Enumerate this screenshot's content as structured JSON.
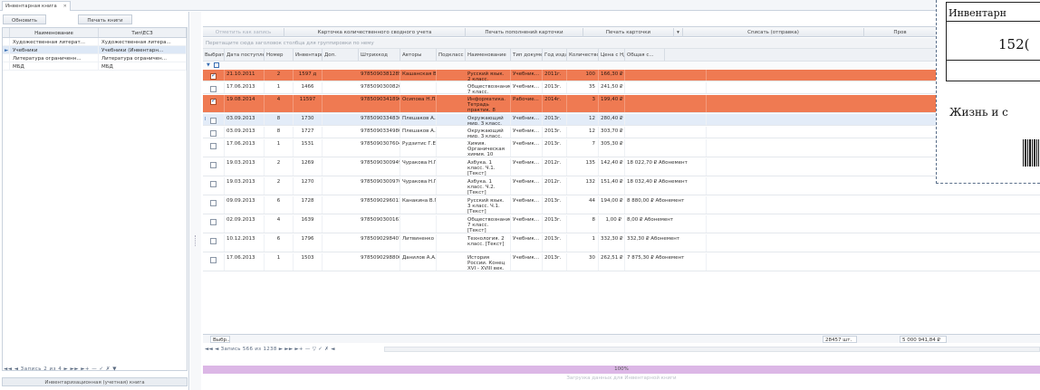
{
  "tabs": [
    {
      "label": "Инвентарная книга"
    }
  ],
  "left_panel": {
    "buttons": [
      "Обновить",
      "Печать книги"
    ],
    "columns": [
      "Наименование",
      "Тип\\ЕСЗ"
    ],
    "rows": [
      {
        "name": "Художественная литерат...",
        "type": "Художественная литера...",
        "selected": false
      },
      {
        "name": "Учебники",
        "type": "Учебники (Инвентарн...",
        "selected": true
      },
      {
        "name": "Литература ограниченн...",
        "type": "Литература ограничен...",
        "selected": false
      },
      {
        "name": "МБД",
        "type": "МБД",
        "selected": false
      }
    ],
    "nav_text": "◄◄ ◄ Запись 2 из 4 ► ►► ►+ — ✓ ✗ ▼",
    "footer": "Инвентаризационная (учетная) книга"
  },
  "toolbar": {
    "buttons": [
      {
        "label": "Отметить как запись",
        "disabled": true
      },
      {
        "label": "Карточка количественного сводного учета",
        "disabled": false
      },
      {
        "label": "Печать пополнений карточки",
        "disabled": false
      },
      {
        "label": "Печать карточки",
        "disabled": false
      },
      {
        "label": "Списать (отправка)",
        "disabled": false
      },
      {
        "label": "Пров",
        "disabled": false
      }
    ],
    "group_panel_hint": "Перетащите сюда заголовок столбца для группировки по нему"
  },
  "grid": {
    "columns": [
      "Выбрать",
      "Дата поступления",
      "Номер",
      "Инвентарный номер",
      "Доп.",
      "Штрихкод",
      "Авторы",
      "Подкласс",
      "Наименование",
      "Тип документа",
      "Год издания",
      "Количество",
      "Цена с НДС",
      "Общая с..."
    ],
    "rows": [
      {
        "checked": true,
        "date": "21.10.2011",
        "num": "2",
        "inv": "1597 д",
        "barcode": "9785090381285",
        "author": "Кашанская В.П.",
        "title": "Русский язык. 2 класс. [Текст]",
        "doctype": "Учебник...",
        "year": "2011г.",
        "qty": "100",
        "price": "166,30 ₽",
        "total": "",
        "style": "hl"
      },
      {
        "checked": false,
        "date": "17.06.2013",
        "num": "1",
        "inv": "1466",
        "barcode": "9785090300826",
        "author": "",
        "title": "Обществознание. 7 класс. [Текст]",
        "doctype": "Учебник...",
        "year": "2013г.",
        "qty": "35",
        "price": "241,50 ₽",
        "total": "",
        "style": ""
      },
      {
        "checked": true,
        "date": "19.08.2014",
        "num": "4",
        "inv": "11597",
        "barcode": "9785090341896",
        "author": "Осипова Н.Л....",
        "title": "Информатика. Тетрадь практик. 8 класс, ч. 2. [Текст]",
        "doctype": "Рабочие...",
        "year": "2014г.",
        "qty": "3",
        "price": "199,40 ₽",
        "total": "",
        "style": "hl"
      },
      {
        "checked": false,
        "date": "03.09.2013",
        "num": "8",
        "inv": "1730",
        "barcode": "9785090334836",
        "author": "Плешаков А.А.",
        "title": "Окружающий мир. 3 класс. Ч.1. [Текст]",
        "doctype": "Учебник...",
        "year": "2013г.",
        "qty": "12",
        "price": "280,40 ₽",
        "total": "",
        "style": "cur"
      },
      {
        "checked": false,
        "date": "03.09.2013",
        "num": "8",
        "inv": "1727",
        "barcode": "9785090334980",
        "author": "Плешаков А.А.",
        "title": "Окружающий мир. 3 класс. Ч.2. [Текст]",
        "doctype": "Учебник...",
        "year": "2013г.",
        "qty": "12",
        "price": "303,70 ₽",
        "total": "",
        "style": ""
      },
      {
        "checked": false,
        "date": "17.06.2013",
        "num": "1",
        "inv": "1531",
        "barcode": "9785090307604",
        "author": "Рудзитис Г.Е.",
        "title": "Химия. Органическая химия. 10 класс. [Текст]",
        "doctype": "Учебник...",
        "year": "2013г.",
        "qty": "7",
        "price": "305,30 ₽",
        "total": "",
        "style": ""
      },
      {
        "checked": false,
        "date": "19.03.2013",
        "num": "2",
        "inv": "1269",
        "barcode": "9785090300949",
        "author": "Чуракова Н.Г....",
        "title": "Азбука. 1 класс. Ч.1. [Текст]",
        "doctype": "Учебник...",
        "year": "2012г.",
        "qty": "135",
        "price": "142,40 ₽",
        "total": "18 022,70 ₽ Абонемент",
        "style": ""
      },
      {
        "checked": false,
        "date": "19.03.2013",
        "num": "2",
        "inv": "1270",
        "barcode": "9785090300970",
        "author": "Чуракова Н.Г....",
        "title": "Азбука. 1 класс. Ч.2. [Текст]",
        "doctype": "Учебник...",
        "year": "2012г.",
        "qty": "132",
        "price": "151,40 ₽",
        "total": "18 032,40 ₽ Абонемент",
        "style": ""
      },
      {
        "checked": false,
        "date": "09.09.2013",
        "num": "6",
        "inv": "1728",
        "barcode": "9785090296011",
        "author": "Канакина В.П.",
        "title": "Русский язык. 3 класс. Ч.1. [Текст]",
        "doctype": "Учебник...",
        "year": "2013г.",
        "qty": "44",
        "price": "194,00 ₽",
        "total": "8 880,00 ₽ Абонемент",
        "style": ""
      },
      {
        "checked": false,
        "date": "02.09.2013",
        "num": "4",
        "inv": "1639",
        "barcode": "9785090300161",
        "author": "",
        "title": "Обществознание. 7 класс. [Текст]",
        "doctype": "Учебник...",
        "year": "2013г.",
        "qty": "8",
        "price": "1,00 ₽",
        "total": "8,00 ₽ Абонемент",
        "style": ""
      },
      {
        "checked": false,
        "date": "10.12.2013",
        "num": "6",
        "inv": "1796",
        "barcode": "9785090298407",
        "author": "Литвиненко Н.В",
        "title": "Технология. 2 класс. [Текст]",
        "doctype": "Учебник...",
        "year": "2013г.",
        "qty": "1",
        "price": "332,30 ₽",
        "total": "332,30 ₽ Абонемент",
        "style": ""
      },
      {
        "checked": false,
        "date": "17.06.2013",
        "num": "1",
        "inv": "1503",
        "barcode": "9785090298800",
        "author": "Данилов А.А.",
        "title": "История России. Конец XVI - XVIII век. 7 класс. [Текст]",
        "doctype": "Учебник...",
        "year": "2013г.",
        "qty": "30",
        "price": "262,51 ₽",
        "total": "7 875,30 ₽ Абонемент",
        "style": ""
      }
    ]
  },
  "summary": {
    "label": "Выбр...",
    "count": "28457 шт.",
    "sum": "5 000 941,84 ₽"
  },
  "main_nav": "◄◄ ◄ Запись 566 из 1238 ► ►► ►+ — ▽ ✓ ✗ ◄",
  "progress_label": "100%",
  "status_text": "Загрузка данных для Инвентарной книги",
  "overlay": {
    "header": "Инвентарн",
    "number": "152(",
    "subtitle": "Жизнь и с"
  }
}
